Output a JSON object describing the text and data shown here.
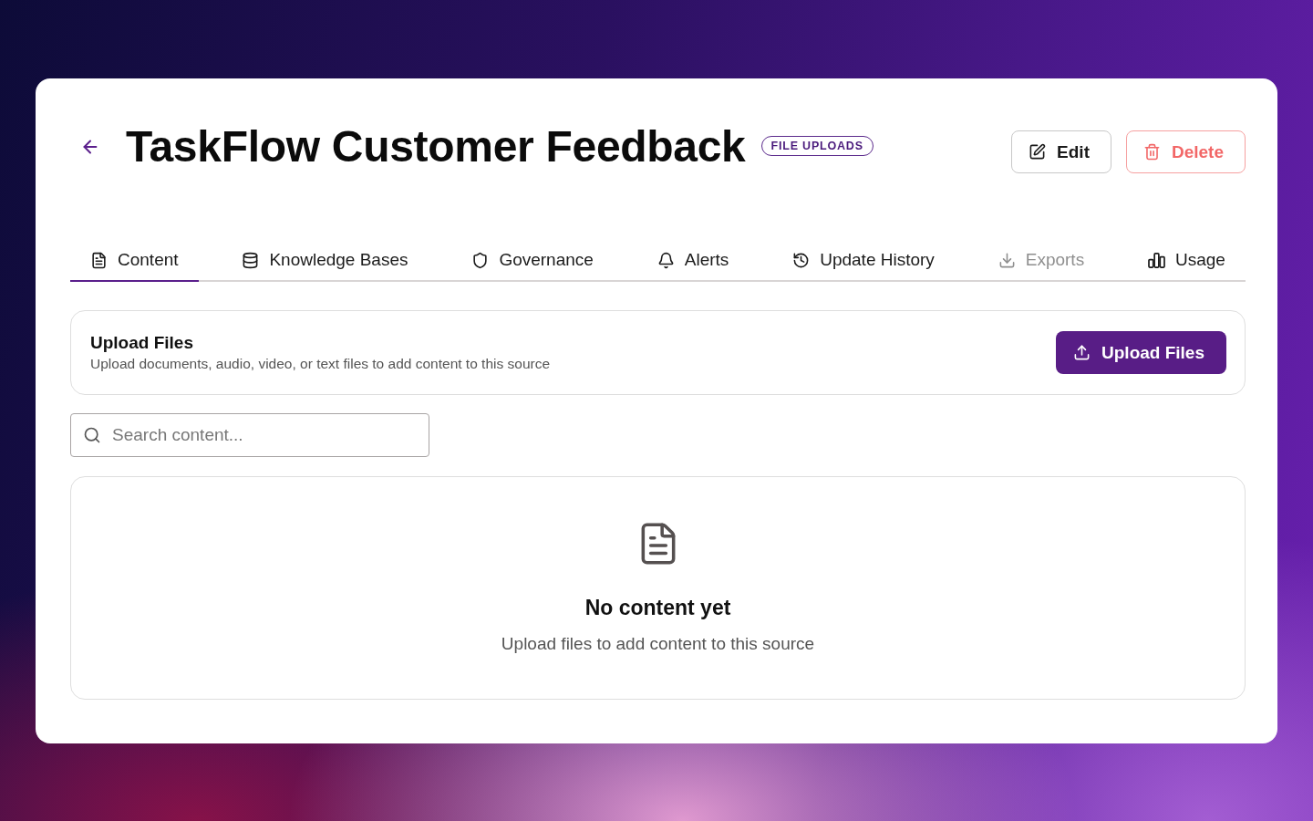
{
  "header": {
    "title": "TaskFlow Customer Feedback",
    "badge": "FILE UPLOADS",
    "buttons": [
      {
        "label": "Edit",
        "kind": "edit"
      },
      {
        "label": "Delete",
        "kind": "danger"
      }
    ]
  },
  "tabs": [
    {
      "label": "Content",
      "selected": true,
      "disabled": false
    },
    {
      "label": "Knowledge Bases",
      "selected": false,
      "disabled": false
    },
    {
      "label": "Governance",
      "selected": false,
      "disabled": false
    },
    {
      "label": "Alerts",
      "selected": false,
      "disabled": false
    },
    {
      "label": "Update History",
      "selected": false,
      "disabled": false
    },
    {
      "label": "Exports",
      "selected": false,
      "disabled": true
    },
    {
      "label": "Usage",
      "selected": false,
      "disabled": false
    }
  ],
  "upload_panel": {
    "title": "Upload Files",
    "description": "Upload documents, audio, video, or text files to add content to this source",
    "button": "Upload Files"
  },
  "search": {
    "placeholder": "Search content..."
  },
  "empty_state": {
    "title": "No content yet",
    "message": "Upload files to add content to this source"
  }
}
